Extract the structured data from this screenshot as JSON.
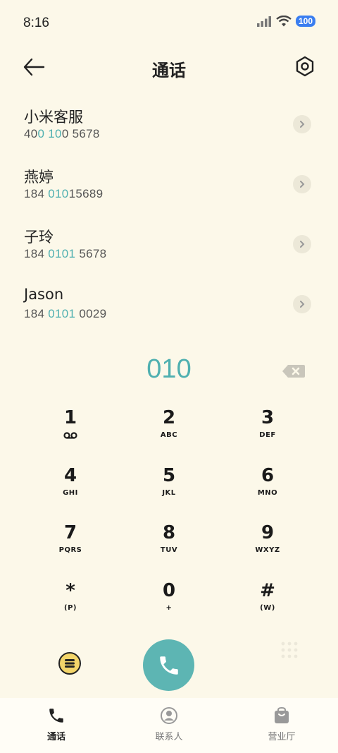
{
  "status_bar": {
    "time": "8:16",
    "battery": "100"
  },
  "header": {
    "title": "通话"
  },
  "contacts": [
    {
      "name": "小米客服",
      "number_parts": [
        "40",
        "0 10",
        "0 5678"
      ]
    },
    {
      "name": "燕婷",
      "number_parts": [
        "184 ",
        "010",
        "15689"
      ]
    },
    {
      "name": "子玲",
      "number_parts": [
        "184 ",
        "0101",
        " 5678"
      ]
    },
    {
      "name": "Jason",
      "number_parts": [
        "184 ",
        "0101",
        " 0029"
      ]
    }
  ],
  "dialer": {
    "entered": "010"
  },
  "keypad": [
    {
      "num": "1",
      "sub": ""
    },
    {
      "num": "2",
      "sub": "ABC"
    },
    {
      "num": "3",
      "sub": "DEF"
    },
    {
      "num": "4",
      "sub": "GHI"
    },
    {
      "num": "5",
      "sub": "JKL"
    },
    {
      "num": "6",
      "sub": "MNO"
    },
    {
      "num": "7",
      "sub": "PQRS"
    },
    {
      "num": "8",
      "sub": "TUV"
    },
    {
      "num": "9",
      "sub": "WXYZ"
    },
    {
      "num": "*",
      "sub": "(P)"
    },
    {
      "num": "0",
      "sub": "+"
    },
    {
      "num": "#",
      "sub": "(W)"
    }
  ],
  "bottom_nav": [
    {
      "label": "通话",
      "icon": "phone-icon",
      "active": true
    },
    {
      "label": "联系人",
      "icon": "person-icon",
      "active": false
    },
    {
      "label": "营业厅",
      "icon": "bag-icon",
      "active": false
    }
  ],
  "colors": {
    "background": "#fcf8e9",
    "accent": "#4fb0b0",
    "call_button": "#5db5b3",
    "battery": "#3a7ef0",
    "menu_button": "#f3d56a"
  }
}
